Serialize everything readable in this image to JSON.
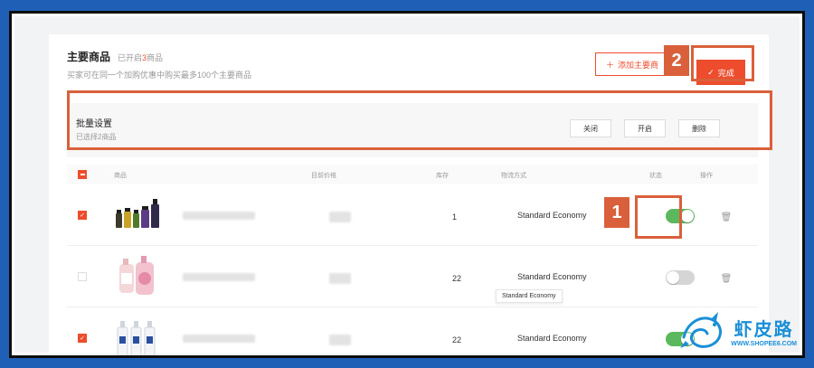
{
  "header": {
    "title": "主要商品",
    "enabled_prefix": "已开启",
    "enabled_num": "3",
    "enabled_suffix": "商品",
    "subtitle": "买家可在同一个加购优惠中购买最多100个主要商品",
    "add_button_label": "添加主要商",
    "done_button_label": "完成"
  },
  "batch": {
    "title": "批量设置",
    "selected_text": "已选择2商品",
    "buttons": [
      "关闭",
      "开启",
      "删除"
    ]
  },
  "table": {
    "columns": [
      "商品",
      "目前价格",
      "库存",
      "物流方式",
      "状态",
      "操作"
    ],
    "rows": [
      {
        "checked": true,
        "stock": "1",
        "shipping": "Standard Economy",
        "enabled": true
      },
      {
        "checked": false,
        "stock": "22",
        "shipping": "Standard Economy",
        "enabled": false
      },
      {
        "checked": true,
        "stock": "22",
        "shipping": "Standard Economy",
        "enabled": true
      }
    ]
  },
  "tooltip": "Standard Economy",
  "callouts": [
    "1",
    "2"
  ],
  "watermark": {
    "name": "虾皮路",
    "url": "WWW.SHOPEE6.COM"
  },
  "colors": {
    "accent": "#ee4d2d",
    "highlight": "#d9603b",
    "toggle_on": "#5cb85c",
    "frame": "#1f5fb5"
  }
}
